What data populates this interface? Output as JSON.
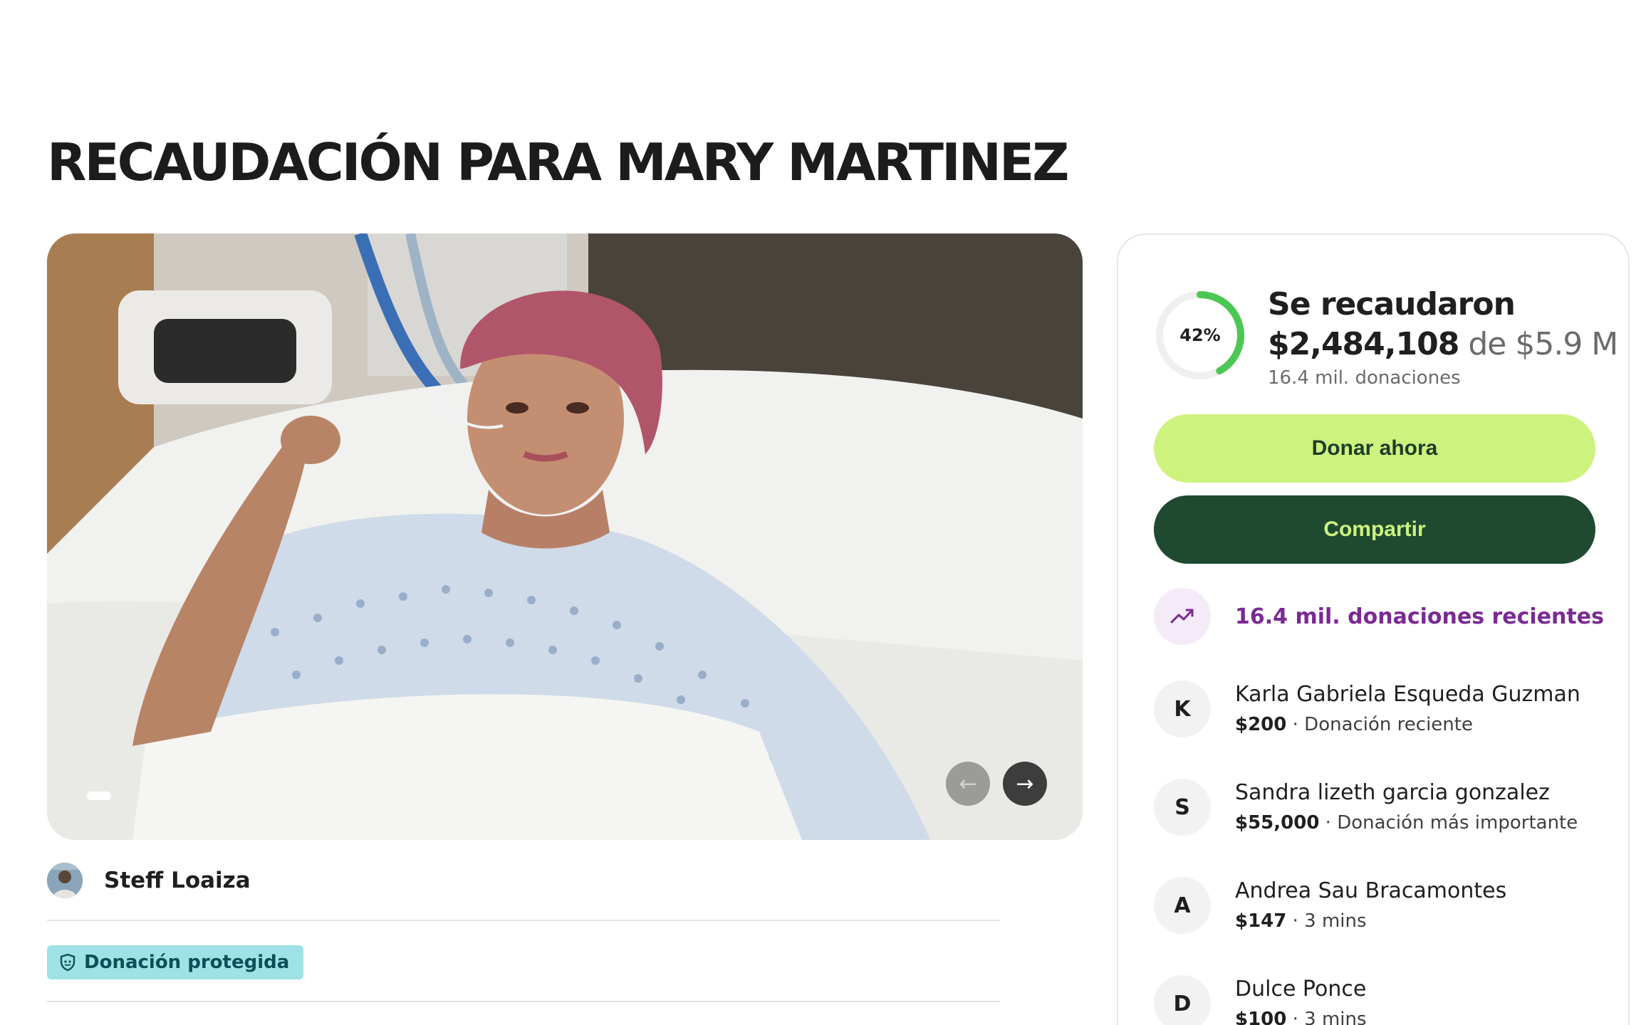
{
  "page": {
    "title": "RECAUDACIÓN PARA MARY MARTINEZ"
  },
  "hero": {
    "prev_arrow": "←",
    "next_arrow": "→"
  },
  "organizer": {
    "name": "Steff Loaiza"
  },
  "badge": {
    "label": "Donación protegida",
    "icon": "shield-icon"
  },
  "summary": {
    "percent": "42%",
    "percent_value": 0.42,
    "heading": "Se recaudaron",
    "amount": "$2,484,108",
    "goal": "de $5.9 M",
    "donations": "16.4 mil. donaciones",
    "ring_color": "#4cc753"
  },
  "actions": {
    "donate_label": "Donar ahora",
    "share_label": "Compartir"
  },
  "recent": {
    "label": "16.4 mil. donaciones recientes",
    "icon": "trending-up-icon"
  },
  "donors": [
    {
      "initial": "K",
      "name": "Karla Gabriela Esqueda Guzman",
      "amount": "$200",
      "note": " · Donación reciente"
    },
    {
      "initial": "S",
      "name": "Sandra lizeth garcia gonzalez",
      "amount": "$55,000",
      "note": " · Donación más importante"
    },
    {
      "initial": "A",
      "name": "Andrea Sau Bracamontes",
      "amount": "$147",
      "note": " · 3 mins"
    },
    {
      "initial": "D",
      "name": "Dulce Ponce",
      "amount": "$100",
      "note": " · 3 mins"
    }
  ]
}
